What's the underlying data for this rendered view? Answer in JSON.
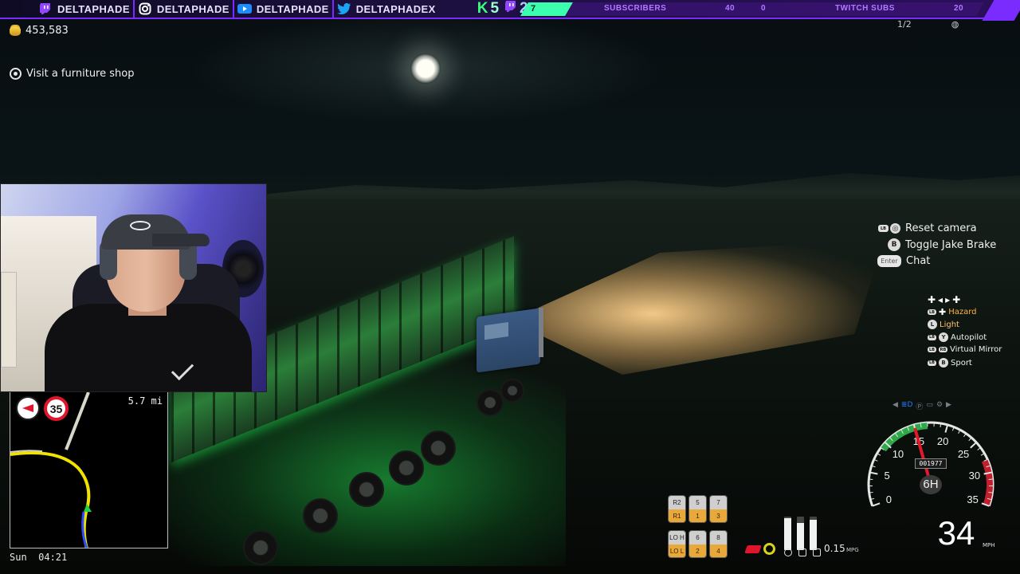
{
  "social_bar": {
    "handles": [
      {
        "platform": "twitch",
        "icon": "twitch-icon",
        "name": "DELTAPHADE"
      },
      {
        "platform": "instagram",
        "icon": "instagram-icon",
        "name": "DELTAPHADE"
      },
      {
        "platform": "youtube",
        "icon": "youtube-icon",
        "name": "DELTAPHADE"
      },
      {
        "platform": "twitter",
        "icon": "twitter-icon",
        "name": "DELTAPHADEX"
      }
    ],
    "kick_count": "5",
    "twitch_count": "2",
    "goals": {
      "subscribers_progress": "7",
      "subscribers_label": "SUBSCRIBERS",
      "subscribers_goal": "40",
      "twitch_subs_current": "0",
      "twitch_subs_label": "TWITCH SUBS",
      "twitch_subs_goal": "20"
    },
    "accent_color": "#7a2cff",
    "kick_color": "#39ff7a"
  },
  "hud": {
    "money": "453,583",
    "objective": "Visit a furniture shop",
    "top_right_count": "1/2"
  },
  "minimap": {
    "speed_limit": "35",
    "distance": "5.7 mi",
    "clock": "Sun  04:21"
  },
  "controls": {
    "main": [
      {
        "button": "LB+R3",
        "label": "Reset camera"
      },
      {
        "button": "B",
        "label": "Toggle Jake Brake"
      },
      {
        "button": "Enter",
        "label": "Chat"
      }
    ],
    "small": [
      {
        "button": "LB+D-pad",
        "label": "Hazard",
        "color": "#ffb347"
      },
      {
        "button": "L",
        "label": "Light",
        "color": "#ffc56e"
      },
      {
        "button": "LB+Y",
        "label": "Autopilot"
      },
      {
        "button": "LB+RB",
        "label": "Virtual Mirror"
      },
      {
        "button": "LB+B",
        "label": "Sport"
      }
    ]
  },
  "gearbox": {
    "gears": [
      {
        "top": "R2",
        "bottom": "R1"
      },
      {
        "top": "5",
        "bottom": "1"
      },
      {
        "top": "7",
        "bottom": "3"
      },
      {
        "top": "LO H",
        "bottom": "LO L"
      },
      {
        "top": "6",
        "bottom": "2"
      },
      {
        "top": "8",
        "bottom": "4"
      }
    ]
  },
  "dashboard": {
    "fuel_economy": "0.15",
    "fuel_unit": "MPG",
    "bars": [
      0.95,
      0.82,
      0.9
    ],
    "odometer": "001977",
    "current_gear": "6H",
    "speed": "34",
    "speed_unit": "MPH",
    "speedo_ticks": [
      "0",
      "5",
      "10",
      "15",
      "20",
      "25",
      "30",
      "35"
    ],
    "needle_value": 15
  }
}
